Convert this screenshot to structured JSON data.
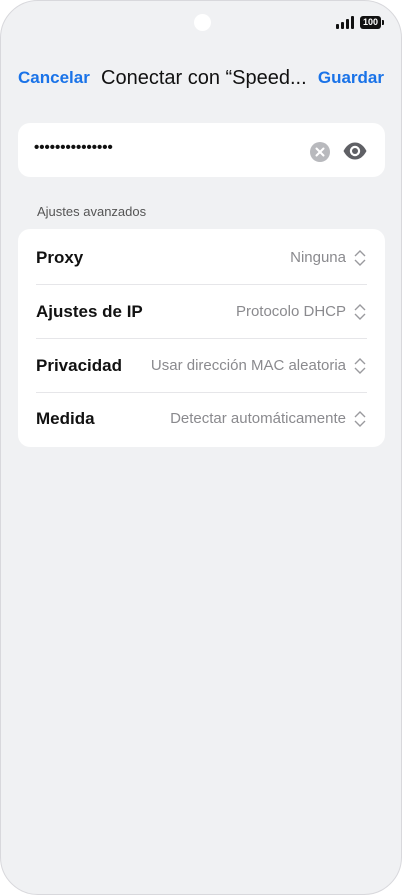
{
  "status_bar": {
    "battery": "100",
    "signal_icon": "signal-bars-icon",
    "battery_icon": "battery-icon"
  },
  "header": {
    "cancel_label": "Cancelar",
    "title": "Conectar con “Speed...",
    "save_label": "Guardar"
  },
  "password": {
    "value": "•••••••••••••••",
    "clear_icon": "clear-icon",
    "visibility_icon": "eye-icon"
  },
  "advanced": {
    "section_label": "Ajustes avanzados",
    "rows": [
      {
        "label": "Proxy",
        "value": "Ninguna"
      },
      {
        "label": "Ajustes de IP",
        "value": "Protocolo DHCP"
      },
      {
        "label": "Privacidad",
        "value": "Usar dirección MAC aleatoria"
      },
      {
        "label": "Medida",
        "value": "Detectar automáticamente"
      }
    ]
  },
  "colors": {
    "accent": "#1a73e8",
    "background": "#f0f1f3",
    "card": "#ffffff",
    "secondary_text": "#8a8a8e"
  }
}
